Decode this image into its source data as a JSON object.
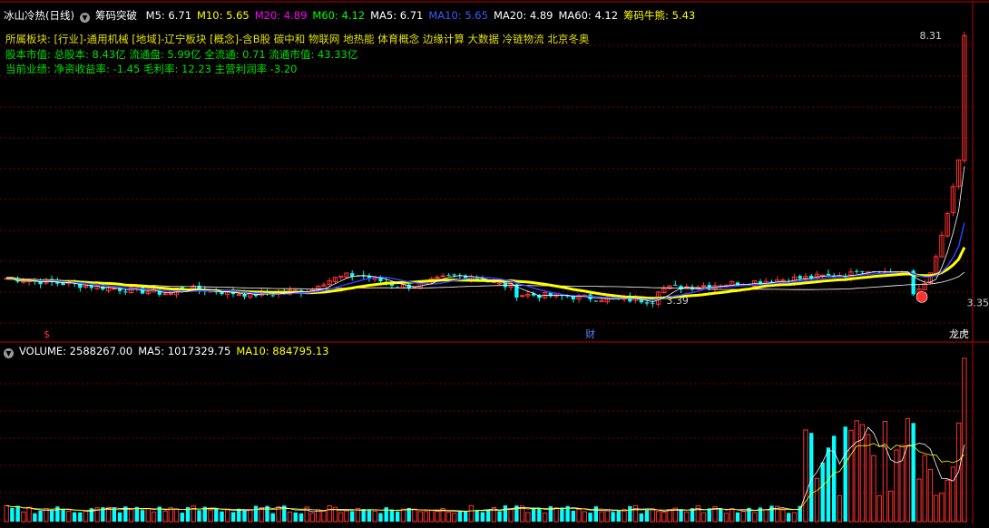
{
  "header": {
    "stock_name": "冰山冷热(日线)",
    "indicator_name": "筹码突破",
    "indicators": [
      {
        "label": "M5: 6.71",
        "color": "#ffffff"
      },
      {
        "label": "M10: 5.65",
        "color": "#ffff00"
      },
      {
        "label": "M20: 4.89",
        "color": "#ff00ff"
      },
      {
        "label": "M60: 4.12",
        "color": "#00ff00"
      },
      {
        "label": "MA5: 6.71",
        "color": "#ffffff"
      },
      {
        "label": "MA10: 5.65",
        "color": "#3a5cff"
      },
      {
        "label": "MA20: 4.89",
        "color": "#ffffff"
      },
      {
        "label": "MA60: 4.12",
        "color": "#ffffff"
      },
      {
        "label": "筹码牛熊: 5.43",
        "color": "#ffff00"
      }
    ]
  },
  "info": {
    "sector_label": "所属板块:",
    "sector_value": "[行业]-通用机械 [地域]-辽宁板块 [概念]-含B股 碳中和 物联网 地热能 体育概念 边缘计算 大数据 冷链物流 北京冬奥",
    "capital_label": "股本市值:",
    "capital_value": "总股本: 8.43亿 流通盘: 5.99亿 全流通: 0.71 流通市值: 43.33亿",
    "perf_label": "当前业绩:",
    "perf_value": "净资收益率: -1.45 毛利率: 12.23 主营利润率 -3.20"
  },
  "volume_header": [
    {
      "label": "VOLUME: 2588267.00",
      "color": "#ffffff"
    },
    {
      "label": "MA5: 1017329.75",
      "color": "#ffffff"
    },
    {
      "label": "MA10: 884795.13",
      "color": "#ffff00"
    }
  ],
  "markers": {
    "left_marker": "$",
    "fin_marker": "财",
    "top_marker": "龙虎"
  },
  "colors": {
    "up": "#ff3232",
    "down": "#00ffff",
    "grid": "#7a0000",
    "divider": "#c00000",
    "ma_main": "#ffff00",
    "ma_blue": "#3040ff"
  },
  "chart_data": [
    {
      "type": "candlestick",
      "price_labels": [
        {
          "text": "8.31",
          "value": 8.31,
          "kind": "max"
        },
        {
          "text": "3.35",
          "value": 3.35,
          "kind": "right_axis"
        },
        {
          "text": "3.39",
          "value": 3.39,
          "kind": "min"
        }
      ],
      "ylim": [
        2.9,
        8.6
      ],
      "num_bars": 170,
      "recent_closes": [
        3.5,
        3.6,
        3.7,
        3.9,
        4.2,
        4.6,
        5.0,
        5.5,
        6.0,
        8.31
      ]
    },
    {
      "type": "bar",
      "series_name": "VOLUME",
      "last_value": 2588267.0,
      "ma5": 1017329.75,
      "ma10": 884795.13
    }
  ]
}
